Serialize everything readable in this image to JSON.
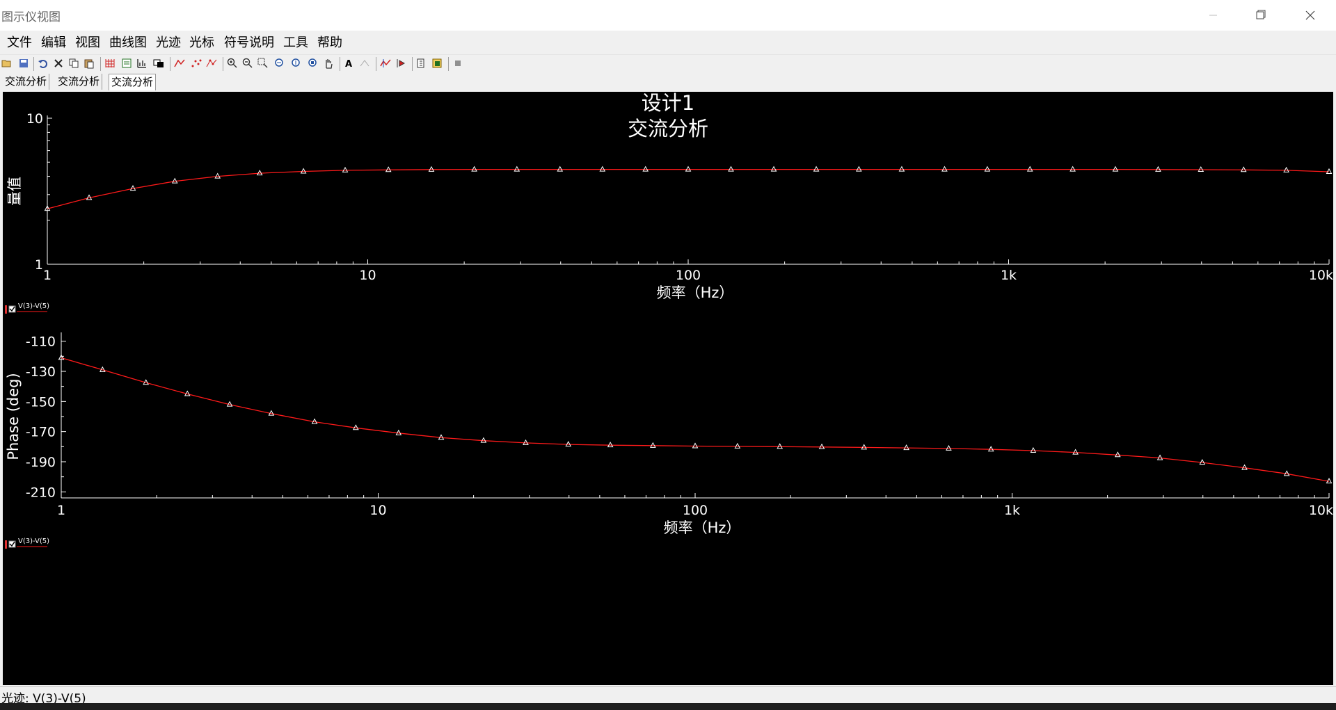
{
  "window": {
    "title": "图示仪视图"
  },
  "menu": [
    "文件",
    "编辑",
    "视图",
    "曲线图",
    "光迹",
    "光标",
    "符号说明",
    "工具",
    "帮助"
  ],
  "tabs": [
    "交流分析",
    "交流分析",
    "交流分析"
  ],
  "plot": {
    "title": "设计1",
    "subtitle": "交流分析"
  },
  "status": {
    "text": "光迹: V(3)-V(5)"
  },
  "colors": {
    "background": "#000000",
    "trace": "#ff1a1a",
    "marker": "#ffffff",
    "axis": "#ffffff"
  },
  "chart_data": [
    {
      "type": "line",
      "xlabel": "频率（Hz）",
      "ylabel": "量值",
      "xscale": "log",
      "yscale": "log",
      "xlim": [
        1,
        10000
      ],
      "ylim": [
        1,
        10
      ],
      "xticks": [
        "1",
        "10",
        "100",
        "1k",
        "10k"
      ],
      "yticks": [
        "1",
        "10"
      ],
      "legend": "V(3)-V(5)",
      "series": [
        {
          "name": "V(3)-V(5)",
          "x": [
            1,
            1.35,
            1.85,
            2.5,
            3.4,
            4.6,
            6.3,
            8.5,
            11.6,
            15.8,
            21.5,
            29.2,
            39.8,
            54,
            73.6,
            100,
            136,
            185,
            251,
            341,
            464,
            631,
            858,
            1166,
            1585,
            2154,
            2929,
            3981,
            5412,
            7356,
            10000
          ],
          "y": [
            2.4,
            2.85,
            3.3,
            3.7,
            4.0,
            4.2,
            4.32,
            4.4,
            4.43,
            4.45,
            4.46,
            4.46,
            4.46,
            4.46,
            4.46,
            4.46,
            4.46,
            4.46,
            4.46,
            4.46,
            4.46,
            4.46,
            4.46,
            4.46,
            4.46,
            4.46,
            4.45,
            4.44,
            4.43,
            4.4,
            4.3
          ]
        }
      ]
    },
    {
      "type": "line",
      "xlabel": "频率（Hz）",
      "ylabel": "Phase (deg)",
      "xscale": "log",
      "xlim": [
        1,
        10000
      ],
      "ylim": [
        -214,
        -106
      ],
      "xticks": [
        "1",
        "10",
        "100",
        "1k",
        "10k"
      ],
      "yticks": [
        "-110",
        "-130",
        "-150",
        "-170",
        "-190",
        "-210"
      ],
      "legend": "V(3)-V(5)",
      "series": [
        {
          "name": "V(3)-V(5)",
          "x": [
            1,
            1.35,
            1.85,
            2.5,
            3.4,
            4.6,
            6.3,
            8.5,
            11.6,
            15.8,
            21.5,
            29.2,
            39.8,
            54,
            73.6,
            100,
            136,
            185,
            251,
            341,
            464,
            631,
            858,
            1166,
            1585,
            2154,
            2929,
            3981,
            5412,
            7356,
            10000
          ],
          "y": [
            -121,
            -129,
            -137.5,
            -145,
            -152,
            -158,
            -163.5,
            -167.5,
            -171,
            -174,
            -176,
            -177.5,
            -178.5,
            -179,
            -179.3,
            -179.6,
            -179.8,
            -180,
            -180.2,
            -180.5,
            -180.8,
            -181.2,
            -181.8,
            -182.6,
            -183.8,
            -185.5,
            -187.5,
            -190.5,
            -194,
            -198,
            -203
          ]
        }
      ]
    }
  ]
}
